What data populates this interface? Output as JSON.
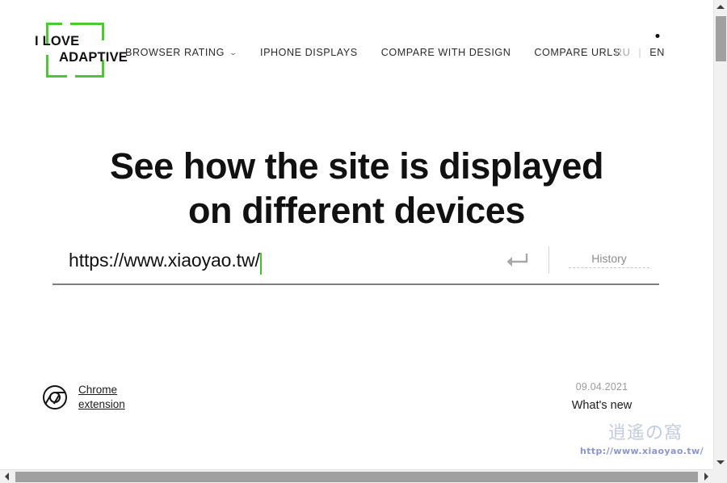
{
  "header": {
    "logo": {
      "line1": "I LOVE",
      "line2": "ADAPTIVE",
      "accent_color": "#4bc832"
    },
    "nav": [
      {
        "label": "BROWSER RATING",
        "has_dropdown": true,
        "caret": "⌄"
      },
      {
        "label": "IPHONE DISPLAYS",
        "has_dropdown": false
      },
      {
        "label": "COMPARE WITH DESIGN",
        "has_dropdown": false
      },
      {
        "label": "COMPARE URLS",
        "has_dropdown": false
      }
    ],
    "language": {
      "inactive": "RU",
      "separator": "|",
      "active": "EN"
    }
  },
  "hero": {
    "line1_normal": "See how the site ",
    "line1_bold": "is displayed",
    "line2": "on different devices"
  },
  "urlform": {
    "value": "https://www.xiaoyao.tw/",
    "placeholder": "https://",
    "submit_icon": "enter-return-arrow",
    "history_label": "History"
  },
  "footer": {
    "chrome": {
      "icon": "chrome-logo-icon",
      "line1": "Chrome",
      "line2": "extension"
    },
    "whatsnew": {
      "date": "09.04.2021",
      "label": "What's new"
    }
  },
  "watermark": {
    "chars": "逍遙の窩",
    "url": "http://www.xiaoyao.tw/"
  },
  "scrollbars": {
    "up_arrow": "▲",
    "down_arrow": "▼",
    "left_arrow": "◀",
    "right_arrow": "▶"
  }
}
